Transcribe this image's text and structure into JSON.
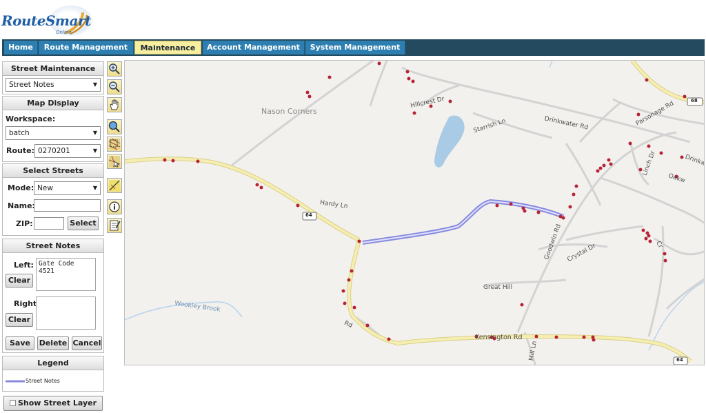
{
  "logo": {
    "text": "RouteSmart",
    "sub": "Online"
  },
  "nav": {
    "tabs": [
      "Home",
      "Route Management",
      "Maintenance",
      "Account Management",
      "System Management"
    ],
    "active_index": 2
  },
  "street_maintenance": {
    "title": "Street Maintenance",
    "selected": "Street Notes"
  },
  "map_display": {
    "title": "Map Display",
    "workspace_label": "Workspace:",
    "workspace_value": "batch",
    "route_label": "Route:",
    "route_value": "0270201"
  },
  "select_streets": {
    "title": "Select Streets",
    "mode_label": "Mode:",
    "mode_value": "New",
    "name_label": "Name:",
    "name_value": "",
    "zip_label": "ZIP:",
    "zip_value": "",
    "select_label": "Select"
  },
  "street_notes": {
    "title": "Street Notes",
    "left_label": "Left:",
    "left_value": "Gate Code\n4521",
    "right_label": "Right:",
    "right_value": "",
    "clear_label": "Clear",
    "save_label": "Save",
    "delete_label": "Delete",
    "cancel_label": "Cancel"
  },
  "legend": {
    "title": "Legend",
    "item": "Street Notes"
  },
  "show_street_layer": "Show Street Layer",
  "tools": [
    "zoom-in-icon",
    "zoom-out-icon",
    "pan-hand-icon",
    "zoom-full-icon",
    "select-area-icon",
    "select-point-icon",
    "select-line-icon",
    "info-icon",
    "notes-icon"
  ],
  "colors": {
    "navbar": "#234a5f",
    "tab": "#2e7fb1",
    "tab_active": "#f7eea0",
    "highway": "#f6eeb0",
    "route_highlight": "#8888dd",
    "stops": "#b52334",
    "water": "#aacbe6"
  },
  "map": {
    "labels": [
      "Nason Corners",
      "Hardy Ln",
      "Hillcrest Dr",
      "Starrish Ln",
      "Drinkwater Rd",
      "Parsonage Rd",
      "Drinkw",
      "Oakw",
      "Linch Dr",
      "Crystal Dr",
      "Goodwin Rd",
      "Great Hill",
      "Kensington Rd",
      "Wookley Brook",
      "Cr",
      "Mill Ln",
      "Rd",
      "64",
      "68",
      "64",
      "64"
    ]
  }
}
